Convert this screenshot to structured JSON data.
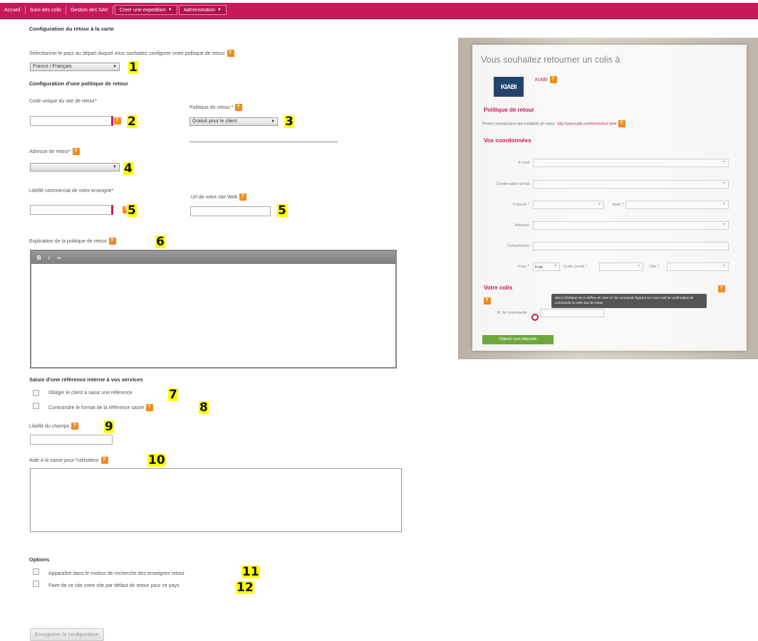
{
  "nav": {
    "items": [
      "Accueil",
      "Suivi des colis",
      "Gestion des SAV",
      "Creer une expedition",
      "Administration"
    ]
  },
  "form": {
    "section_title": "Configuration du retour à la carte",
    "country_prompt": "Sélectionner le pays au départ duquel vous souhaitez configurer votre politique de retour",
    "country_value": "France / Français",
    "policy_config_title": "Configuration d'une politique de retour",
    "site_code_label": "Code unique du site de retour*",
    "return_policy_label": "Politique de retour *",
    "return_policy_value": "Gratuit pour le client",
    "return_address_label": "Adresse de retour*",
    "brand_label": "Libellé commercial de votre enseigne*",
    "website_label": "Url de votre site Web",
    "explanation_label": "Explication de la politique de retour",
    "editor_tools": [
      "B",
      "I",
      "∞"
    ],
    "internal_ref_title": "Saisie d'une référence interne à vos services",
    "force_ref_label": "Obliger le client à saisir une référence",
    "constrain_ref_label": "Contraindre le format de la référence saisie",
    "field_label_label": "Libellé du champs",
    "user_help_label": "Aide à la saisie pour l'utilisateur",
    "options_title": "Options",
    "option_search_label": "Apparaître dans le moteur de recherche des enseignes retour",
    "option_default_label": "Faire de ce site votre site par défaut de retour pour ce pays",
    "save_button": "Enregistrer la configuration"
  },
  "markers": [
    "1",
    "2",
    "3",
    "4",
    "5",
    "5",
    "6",
    "7",
    "8",
    "9",
    "10",
    "11",
    "12"
  ],
  "preview": {
    "title": "Vous souhaitez retourner un colis à",
    "logo_text": "KIABI",
    "brand_name": "KIABI",
    "policy_title": "Politique de retour",
    "policy_text": "Prenez connaissance des modalités de retour :",
    "policy_link": "http://www.kiabi.com/termsofuse.html",
    "contact_title": "Vos coordonnées",
    "email_label": "E-mail",
    "email_confirm_label": "Confirmation Email",
    "firstname_label": "Prénom *",
    "lastname_label": "Nom *",
    "address_label": "Adresse",
    "complement_label": "Complément",
    "country_label": "Pays *",
    "country_value": "Fran",
    "zip_label": "Code postal *",
    "city_label": "Ville *",
    "parcel_title": "Votre colis",
    "order_label": "N° de commande",
    "tooltip_text": "Merci d'indiquer les 5 chiffres de votre N° de commande figurant sur votre mail de confirmation de commande ou votre bon de retour",
    "submit_button": "Obtenir mon étiquette"
  },
  "colors": {
    "brand": "#c8185a",
    "help_icon": "#f08a1c",
    "marker": "#ffff00",
    "preview_button": "#6ea83a"
  }
}
